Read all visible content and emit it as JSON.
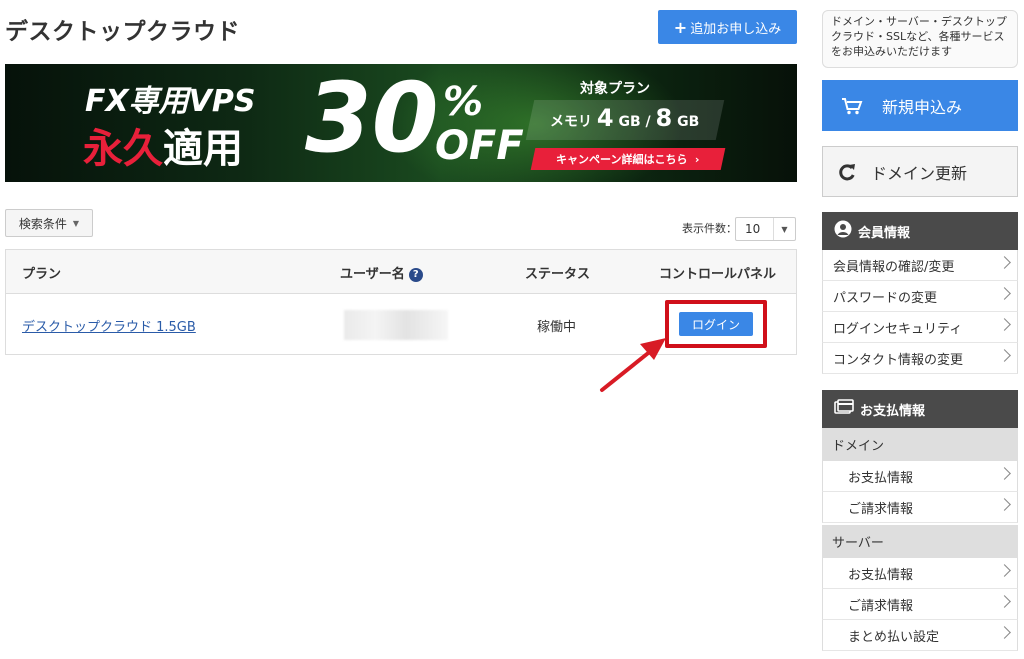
{
  "main": {
    "title": "デスクトップクラウド",
    "add_button": "追加お申し込み",
    "banner": {
      "headline": "FX専用VPS",
      "eikyu": "永久",
      "tekiyo": "適用",
      "percent_big": "30",
      "percent_sign": "%",
      "off": "OFF",
      "plan_label": "対象プラン",
      "memory_label": "メモリ",
      "memory_from": "4",
      "memory_to": "8",
      "memory_unit": "GB",
      "campaign_link": "キャンペーン詳細はこちら"
    },
    "search_conditions": "検索条件",
    "count_label": "表示件数：",
    "count_value": "10",
    "table": {
      "headers": {
        "plan": "プラン",
        "username": "ユーザー名",
        "status": "ステータス",
        "control_panel": "コントロールパネル"
      },
      "rows": [
        {
          "plan": "デスクトップクラウド 1.5GB",
          "status": "稼働中",
          "login": "ログイン"
        }
      ]
    }
  },
  "sidebar": {
    "notice": "ドメイン・サーバー・デスクトップクラウド・SSLなど、各種サービスをお申込みいただけます",
    "new_order": "新規申込み",
    "domain_renew": "ドメイン更新",
    "member_section": {
      "title": "会員情報",
      "items": [
        "会員情報の確認/変更",
        "パスワードの変更",
        "ログインセキュリティ",
        "コンタクト情報の変更"
      ]
    },
    "payment_section": {
      "title": "お支払情報",
      "groups": [
        {
          "label": "ドメイン",
          "items": [
            "お支払情報",
            "ご請求情報"
          ]
        },
        {
          "label": "サーバー",
          "items": [
            "お支払情報",
            "ご請求情報",
            "まとめ払い設定"
          ]
        }
      ]
    }
  },
  "colors": {
    "primary_blue": "#3a87e6",
    "highlight_red": "#d0101a",
    "banner_red": "#e8203a",
    "sidebar_header": "#4a4a4a"
  }
}
